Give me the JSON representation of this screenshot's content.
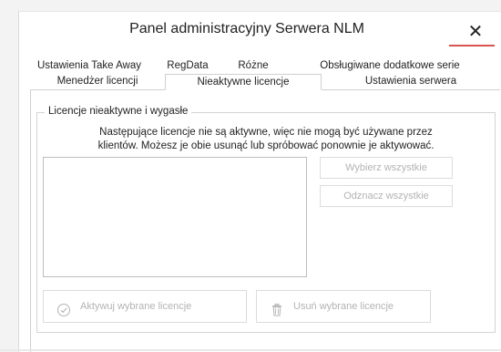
{
  "window": {
    "title": "Panel administracyjny Serwera NLM",
    "close_symbol": "✕",
    "accent_color": "#d9534f"
  },
  "tabs": {
    "top_row": [
      {
        "label": "Ustawienia Take Away"
      },
      {
        "label": "RegData"
      },
      {
        "label": "Różne"
      },
      {
        "label": "Obsługiwane dodatkowe serie"
      }
    ],
    "bottom_row": [
      {
        "label": "Menedżer licencji"
      },
      {
        "label": "Nieaktywne licencje",
        "active": true
      },
      {
        "label": "Ustawienia serwera"
      }
    ]
  },
  "panel": {
    "group_title": "Licencje nieaktywne i wygasłe",
    "description_line1": "Następujące licencje nie są aktywne, więc nie mogą być używane przez",
    "description_line2": "klientów. Możesz je obie usunąć lub spróbować ponownie je aktywować.",
    "license_list": [],
    "select_all_label": "Wybierz wszystkie",
    "deselect_all_label": "Odznacz wszystkie",
    "activate_label": "Aktywuj wybrane licencje",
    "activate_icon": "check-circle-icon",
    "remove_label": "Usuń wybrane licencje",
    "remove_icon": "trash-icon",
    "disabled_text_color": "#b3b3b3"
  }
}
